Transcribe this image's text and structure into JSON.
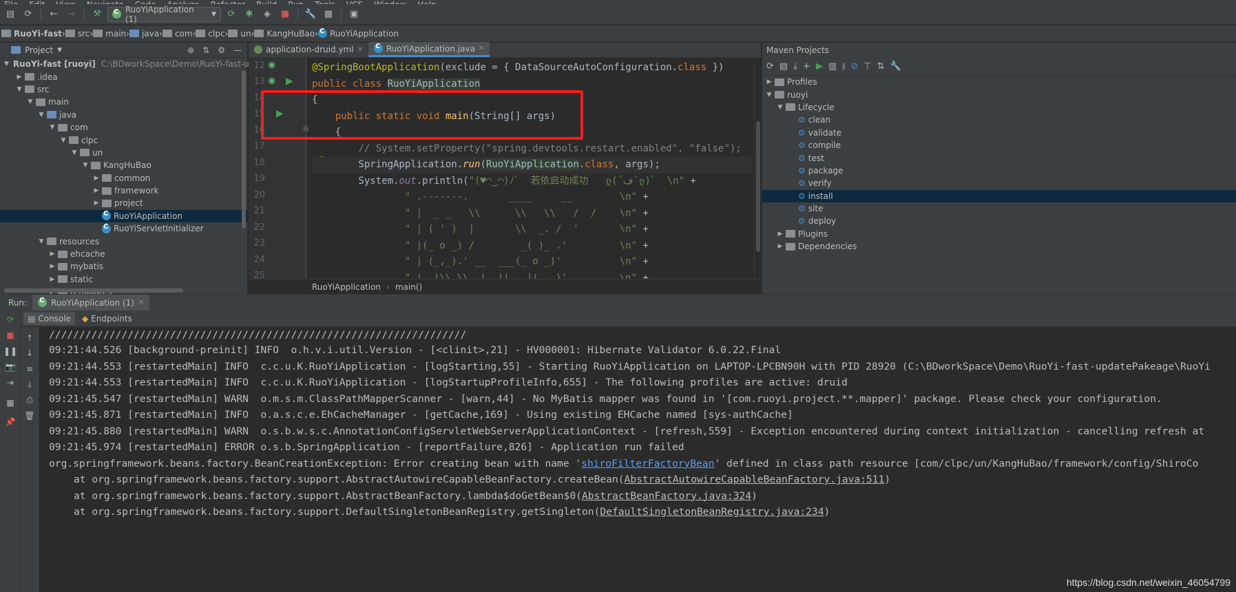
{
  "menu": [
    "File",
    "Edit",
    "View",
    "Navigate",
    "Code",
    "Analyze",
    "Refactor",
    "Build",
    "Run",
    "Tools",
    "VCS",
    "Window",
    "Help"
  ],
  "toolbar": {
    "run_config": "RuoYiApplication (1)"
  },
  "breadcrumb": [
    "RuoYi-fast",
    "src",
    "main",
    "java",
    "com",
    "clpc",
    "un",
    "KangHuBao",
    "RuoYiApplication"
  ],
  "project": {
    "title": "Project",
    "tree": [
      {
        "label": "RuoYi-fast [ruoyi]",
        "path": "C:\\BDworkSpace\\Demo\\RuoYi-fast-updateP",
        "depth": 0,
        "open": true,
        "kind": "module",
        "bold": true
      },
      {
        "label": ".idea",
        "depth": 1,
        "open": false,
        "kind": "folder"
      },
      {
        "label": "src",
        "depth": 1,
        "open": true,
        "kind": "folder"
      },
      {
        "label": "main",
        "depth": 2,
        "open": true,
        "kind": "folder"
      },
      {
        "label": "java",
        "depth": 3,
        "open": true,
        "kind": "folder-blue"
      },
      {
        "label": "com",
        "depth": 4,
        "open": true,
        "kind": "folder"
      },
      {
        "label": "clpc",
        "depth": 5,
        "open": true,
        "kind": "folder"
      },
      {
        "label": "un",
        "depth": 6,
        "open": true,
        "kind": "folder"
      },
      {
        "label": "KangHuBao",
        "depth": 7,
        "open": true,
        "kind": "folder"
      },
      {
        "label": "common",
        "depth": 8,
        "open": false,
        "kind": "folder"
      },
      {
        "label": "framework",
        "depth": 8,
        "open": false,
        "kind": "folder"
      },
      {
        "label": "project",
        "depth": 8,
        "open": false,
        "kind": "folder"
      },
      {
        "label": "RuoYiApplication",
        "depth": 8,
        "kind": "class",
        "selected": true
      },
      {
        "label": "RuoYiServletInitializer",
        "depth": 8,
        "kind": "class"
      },
      {
        "label": "resources",
        "depth": 3,
        "open": true,
        "kind": "folder"
      },
      {
        "label": "ehcache",
        "depth": 4,
        "open": false,
        "kind": "folder"
      },
      {
        "label": "mybatis",
        "depth": 4,
        "open": false,
        "kind": "folder"
      },
      {
        "label": "static",
        "depth": 4,
        "open": false,
        "kind": "folder"
      },
      {
        "label": "templates",
        "depth": 4,
        "open": false,
        "kind": "folder"
      }
    ]
  },
  "editor": {
    "tabs": [
      "application-druid.yml",
      "RuoYiApplication.java"
    ],
    "active_tab": 1,
    "line_numbers": [
      "12",
      "13",
      "14",
      "15",
      "16",
      "17",
      "18",
      "19",
      "20",
      "21",
      "22",
      "23",
      "24",
      "25"
    ],
    "status_crumbs": [
      "RuoYiApplication",
      "main()"
    ]
  },
  "maven": {
    "title": "Maven Projects",
    "tree": [
      {
        "label": "Profiles",
        "depth": 0,
        "open": false
      },
      {
        "label": "ruoyi",
        "depth": 0,
        "open": true
      },
      {
        "label": "Lifecycle",
        "depth": 1,
        "open": true
      },
      {
        "label": "clean",
        "depth": 2,
        "goal": true
      },
      {
        "label": "validate",
        "depth": 2,
        "goal": true
      },
      {
        "label": "compile",
        "depth": 2,
        "goal": true
      },
      {
        "label": "test",
        "depth": 2,
        "goal": true
      },
      {
        "label": "package",
        "depth": 2,
        "goal": true
      },
      {
        "label": "verify",
        "depth": 2,
        "goal": true
      },
      {
        "label": "install",
        "depth": 2,
        "goal": true,
        "selected": true
      },
      {
        "label": "site",
        "depth": 2,
        "goal": true
      },
      {
        "label": "deploy",
        "depth": 2,
        "goal": true
      },
      {
        "label": "Plugins",
        "depth": 1,
        "open": false
      },
      {
        "label": "Dependencies",
        "depth": 1,
        "open": false
      }
    ]
  },
  "run": {
    "label": "Run:",
    "tab": "RuoYiApplication (1)",
    "console_tabs": [
      "Console",
      "Endpoints"
    ]
  },
  "console": {
    "lines": [
      "/////////////////////////////////////////////////////////////////////",
      "09:21:44.526 [background-preinit] INFO  o.h.v.i.util.Version - [<clinit>,21] - HV000001: Hibernate Validator 6.0.22.Final",
      "09:21:44.553 [restartedMain] INFO  c.c.u.K.RuoYiApplication - [logStarting,55] - Starting RuoYiApplication on LAPTOP-LPCBN90H with PID 28920 (C:\\BDworkSpace\\Demo\\RuoYi-fast-updatePakeage\\RuoYi",
      "09:21:44.553 [restartedMain] INFO  c.c.u.K.RuoYiApplication - [logStartupProfileInfo,655] - The following profiles are active: druid",
      "09:21:45.547 [restartedMain] WARN  o.m.s.m.ClassPathMapperScanner - [warn,44] - No MyBatis mapper was found in '[com.ruoyi.project.**.mapper]' package. Please check your configuration.",
      "09:21:45.871 [restartedMain] INFO  o.a.s.c.e.EhCacheManager - [getCache,169] - Using existing EHCache named [sys-authCache]",
      "09:21:45.880 [restartedMain] WARN  o.s.b.w.s.c.AnnotationConfigServletWebServerApplicationContext - [refresh,559] - Exception encountered during context initialization - cancelling refresh at",
      "09:21:45.974 [restartedMain] ERROR o.s.b.SpringApplication - [reportFailure,826] - Application run failed"
    ],
    "error_prefix": "org.springframework.beans.factory.BeanCreationException: Error creating bean with name '",
    "error_bean": "shiroFilterFactoryBean",
    "error_suffix": "' defined in class path resource [com/clpc/un/KangHuBao/framework/config/ShiroCo",
    "trace": [
      {
        "text": "at org.springframework.beans.factory.support.AbstractAutowireCapableBeanFactory.createBean(",
        "link": "AbstractAutowireCapableBeanFactory.java:511",
        "end": ")"
      },
      {
        "text": "at org.springframework.beans.factory.support.AbstractBeanFactory.lambda$doGetBean$0(",
        "link": "AbstractBeanFactory.java:324",
        "end": ")"
      },
      {
        "text": "at org.springframework.beans.factory.support.DefaultSingletonBeanRegistry.getSingleton(",
        "link": "DefaultSingletonBeanRegistry.java:234",
        "end": ")"
      }
    ]
  },
  "watermark": "https://blog.csdn.net/weixin_46054799"
}
